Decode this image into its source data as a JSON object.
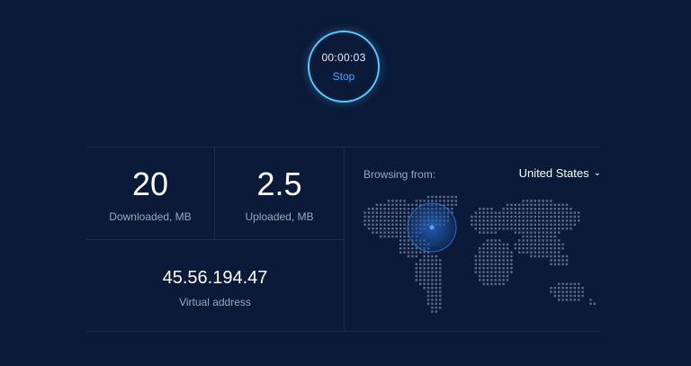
{
  "timer": {
    "time": "00:00:03",
    "stop_label": "Stop"
  },
  "stats": {
    "downloaded": {
      "value": "20",
      "label": "Downloaded, MB"
    },
    "uploaded": {
      "value": "2.5",
      "label": "Uploaded, MB"
    },
    "virtual_address": {
      "value": "45.56.194.47",
      "label": "Virtual address"
    }
  },
  "location": {
    "browsing_from_label": "Browsing from:",
    "country": "United States",
    "chevron_icon": "chevron-down-icon"
  },
  "colors": {
    "background": "#0a1a38",
    "accent": "#4aa8ff",
    "ring": "#5cc6ff",
    "muted_text": "#9aa7bd",
    "map_dots": "#6f7f9b"
  }
}
